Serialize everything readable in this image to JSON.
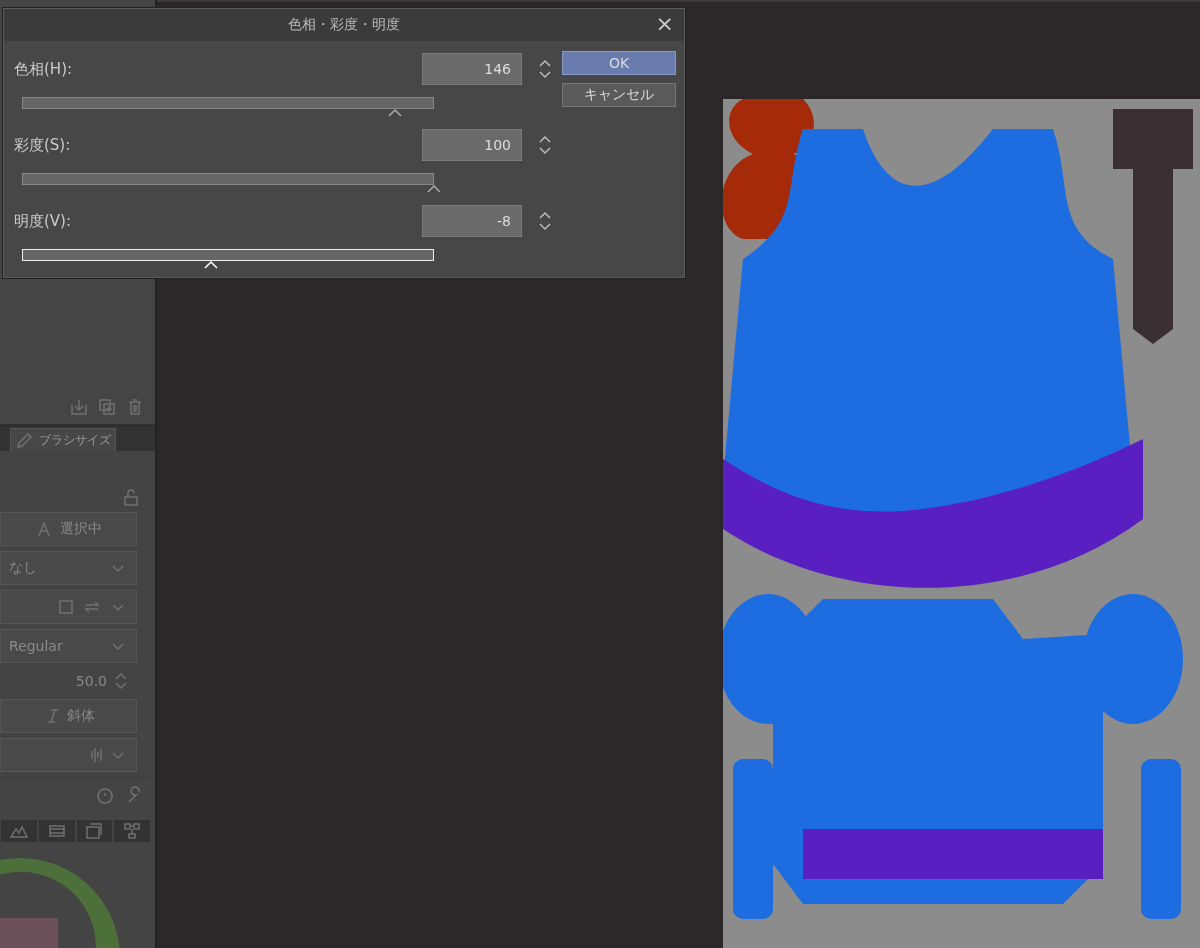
{
  "dialog": {
    "title": "色相・彩度・明度",
    "close": "×",
    "sliders": [
      {
        "label": "色相(H):",
        "value": "146",
        "level": 0.906,
        "focused": false
      },
      {
        "label": "彩度(S):",
        "value": "100",
        "level": 1,
        "focused": false
      },
      {
        "label": "明度(V):",
        "value": "-8",
        "level": 0.459,
        "focused": true
      }
    ],
    "buttons": [
      {
        "label": "OK",
        "default": true
      },
      {
        "label": "キャンセル",
        "default": false
      }
    ]
  },
  "left_panel": {
    "tab": "ブラシサイズ",
    "text_label": "選択中",
    "dropdown_1": "なし",
    "font_dropdown": "Regular",
    "size_value": "50.0",
    "italic_button": "斜体"
  }
}
